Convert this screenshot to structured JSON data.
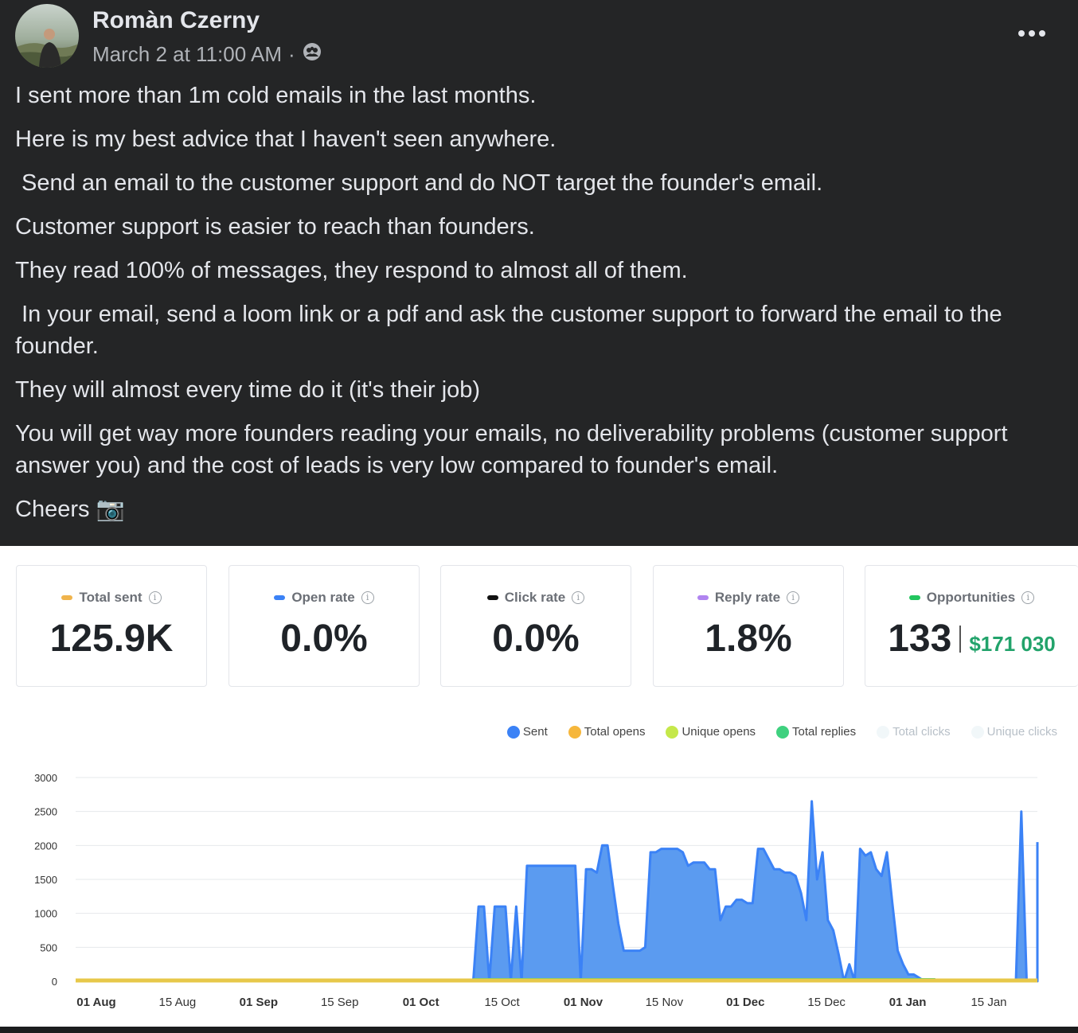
{
  "post": {
    "author": "Romàn Czerny",
    "timestamp": "March 2 at 11:00 AM",
    "separator": "·",
    "audience_icon": "group-audience-icon",
    "more_icon": "more-options-icon",
    "paragraphs": [
      "I sent more than 1m cold emails in the last months.",
      "Here is my best advice that I haven't seen anywhere.",
      " Send an email to the customer support and do NOT target the founder's email.",
      "Customer support is easier to reach than founders.",
      "They read 100% of messages, they respond to almost all of them.",
      " In your email, send a loom link or a pdf and ask the customer support to forward the email to the founder.",
      "They will almost every time do it (it's their job)",
      "You will get way more founders reading your emails, no deliverability problems (customer support answer you) and the cost of leads is very low compared to founder's email.",
      "Cheers 📷"
    ]
  },
  "stats": {
    "total_sent": {
      "label": "Total sent",
      "value": "125.9K",
      "color": "#f0b44c"
    },
    "open_rate": {
      "label": "Open rate",
      "value": "0.0%",
      "color": "#3b82f6"
    },
    "click_rate": {
      "label": "Click rate",
      "value": "0.0%",
      "color": "#111111"
    },
    "reply_rate": {
      "label": "Reply rate",
      "value": "1.8%",
      "color": "#b084f0"
    },
    "opportunities": {
      "label": "Opportunities",
      "count": "133",
      "amount": "$171 030",
      "color": "#22c55e"
    }
  },
  "legend": [
    {
      "name": "Sent",
      "color": "#3b82f6",
      "active": true
    },
    {
      "name": "Total opens",
      "color": "#f6b73c",
      "active": true
    },
    {
      "name": "Unique opens",
      "color": "#c5e84a",
      "active": true
    },
    {
      "name": "Total replies",
      "color": "#3fd17f",
      "active": true
    },
    {
      "name": "Total clicks",
      "color": "#eef6f8",
      "active": false
    },
    {
      "name": "Unique clicks",
      "color": "#eef6f8",
      "active": false
    }
  ],
  "chart_data": {
    "type": "area",
    "ylim": [
      0,
      3000
    ],
    "yticks": [
      0,
      500,
      1000,
      1500,
      2000,
      2500,
      3000
    ],
    "xticks": [
      {
        "label": "01 Aug",
        "bold": true
      },
      {
        "label": "15 Aug",
        "bold": false
      },
      {
        "label": "01 Sep",
        "bold": true
      },
      {
        "label": "15 Sep",
        "bold": false
      },
      {
        "label": "01 Oct",
        "bold": true
      },
      {
        "label": "15 Oct",
        "bold": false
      },
      {
        "label": "01 Nov",
        "bold": true
      },
      {
        "label": "15 Nov",
        "bold": false
      },
      {
        "label": "01 Dec",
        "bold": true
      },
      {
        "label": "15 Dec",
        "bold": false
      },
      {
        "label": "01 Jan",
        "bold": true
      },
      {
        "label": "15 Jan",
        "bold": false
      }
    ],
    "series": [
      {
        "name": "Sent",
        "color": "#3b82f6",
        "fill": "#5b9bf0",
        "x": [
          0,
          74,
          75,
          76,
          77,
          78,
          79,
          80,
          81,
          82,
          83,
          84,
          85,
          86,
          87,
          88,
          89,
          90,
          91,
          92,
          93,
          94,
          95,
          96,
          97,
          98,
          99,
          100,
          101,
          102,
          103,
          104,
          105,
          106,
          107,
          108,
          109,
          110,
          111,
          112,
          113,
          114,
          115,
          116,
          117,
          118,
          119,
          120,
          121,
          122,
          123,
          124,
          125,
          126,
          127,
          128,
          129,
          130,
          131,
          132,
          133,
          134,
          135,
          136,
          137,
          138,
          139,
          140,
          141,
          142,
          143,
          144,
          145,
          146,
          147,
          148,
          149,
          150,
          151,
          152,
          153,
          154,
          155,
          156,
          157,
          158,
          159,
          160,
          161,
          162,
          163,
          164,
          165,
          166,
          167,
          168,
          169,
          170,
          171,
          172,
          173,
          174,
          175,
          176,
          177,
          178,
          179
        ],
        "values": [
          0,
          0,
          1100,
          1100,
          0,
          1100,
          1100,
          1100,
          0,
          1100,
          0,
          1700,
          1700,
          1700,
          1700,
          1700,
          1700,
          1700,
          1700,
          1700,
          1700,
          0,
          1650,
          1650,
          1600,
          2000,
          2000,
          1400,
          850,
          450,
          450,
          450,
          450,
          500,
          1900,
          1900,
          1950,
          1950,
          1950,
          1950,
          1900,
          1700,
          1750,
          1750,
          1750,
          1650,
          1650,
          900,
          1100,
          1100,
          1200,
          1200,
          1150,
          1150,
          1950,
          1950,
          1800,
          1650,
          1650,
          1600,
          1600,
          1550,
          1300,
          900,
          2650,
          1500,
          1900,
          900,
          750,
          400,
          0,
          250,
          0,
          1950,
          1850,
          1900,
          1650,
          1550,
          1900,
          1150,
          450,
          250,
          100,
          100,
          50,
          0,
          0,
          0,
          0,
          0,
          0,
          0,
          0,
          0,
          0,
          0,
          0,
          0,
          0,
          0,
          0,
          0,
          0,
          2500,
          0,
          0,
          0
        ],
        "note_last": [
          2500,
          2050
        ]
      },
      {
        "name": "Total opens",
        "color": "#e7c84a",
        "values_constant": 0
      },
      {
        "name": "Total replies",
        "color": "#3fd17f",
        "values_constant": 30
      }
    ]
  }
}
